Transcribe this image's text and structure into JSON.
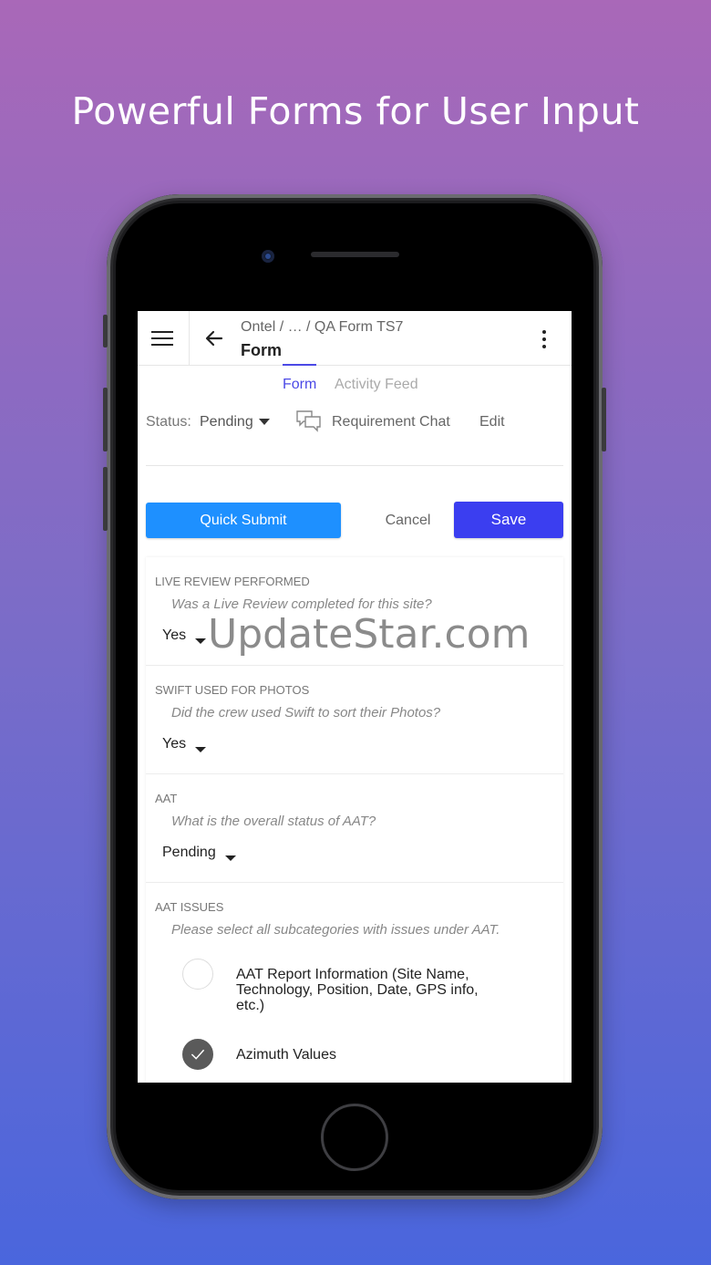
{
  "headline": "Powerful Forms for User Input",
  "topbar": {
    "breadcrumb": "Ontel / … / QA Form TS7",
    "title": "Form"
  },
  "tabs": [
    "Form",
    "Activity Feed"
  ],
  "status": {
    "label": "Status:",
    "value": "Pending"
  },
  "actions": {
    "requirement_chat": "Requirement Chat",
    "edit": "Edit"
  },
  "buttons": {
    "quick_submit": "Quick Submit",
    "cancel": "Cancel",
    "save": "Save"
  },
  "questions": [
    {
      "title": "LIVE REVIEW PERFORMED",
      "help": "Was a Live Review completed for this site?",
      "value": "Yes"
    },
    {
      "title": "SWIFT USED FOR PHOTOS",
      "help": "Did the crew used Swift to sort their Photos?",
      "value": "Yes"
    },
    {
      "title": "AAT",
      "help": "What is the overall status of AAT?",
      "value": "Pending"
    },
    {
      "title": "AAT ISSUES",
      "help": "Please select all subcategories with issues under AAT.",
      "options": [
        {
          "label": "AAT Report Information (Site Name, Technology, Position, Date, GPS info, etc.)",
          "checked": false
        },
        {
          "label": "Azimuth Values",
          "checked": true
        }
      ]
    }
  ],
  "watermark": "UpdateStar.com",
  "colors": {
    "accent": "#4b49e6",
    "quick_submit": "#1e90ff",
    "save": "#3b3ef0"
  }
}
